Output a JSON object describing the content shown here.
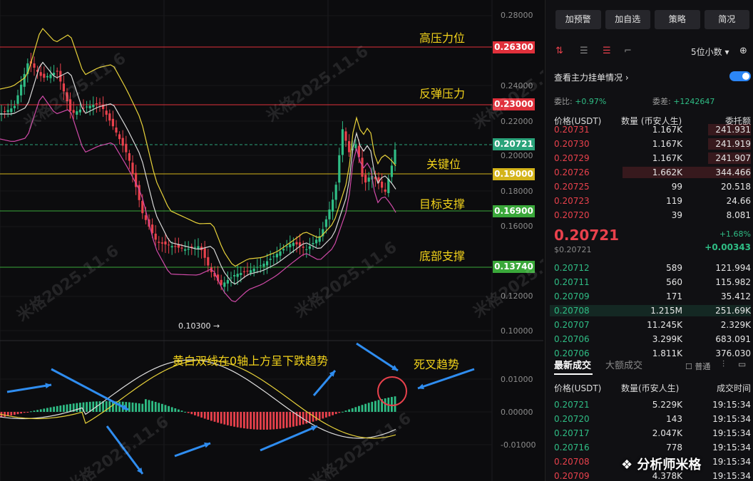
{
  "chart": {
    "axis_ticks": [
      "0.28000",
      "0.24000",
      "0.22000",
      "0.20000",
      "0.18000",
      "0.16000",
      "0.12000",
      "0.10000"
    ],
    "macd_ticks": [
      "0.01000",
      "0.00000",
      "-0.01000"
    ],
    "price_tags": [
      {
        "label": "0.26300",
        "color": "#e0303b"
      },
      {
        "label": "0.23000",
        "color": "#e0303b"
      },
      {
        "label": "0.20721",
        "color": "#2aa37a"
      },
      {
        "label": "0.19000",
        "color": "#d4b41a"
      },
      {
        "label": "0.16900",
        "color": "#3aa83a"
      },
      {
        "label": "0.13740",
        "color": "#3aa83a"
      }
    ],
    "annotations": {
      "high_resistance": "高压力位",
      "rebound_resistance": "反弹压力",
      "key_level": "关键位",
      "target_support": "目标支撑",
      "bottom_support": "底部支撑",
      "macd_note": "黄白双线在0轴上方呈下跌趋势",
      "death_cross": "死叉趋势"
    },
    "low_marker": "0.10300 →",
    "watermark": "米格2025.11.6"
  },
  "panel": {
    "buttons": [
      "加预警",
      "加自选",
      "策略",
      "简况"
    ],
    "decimal_select": "5位小数",
    "main_orders_label": "查看主力挂单情况",
    "commission_ratio_label": "委比:",
    "commission_ratio": "+0.97%",
    "commission_diff_label": "委差:",
    "commission_diff": "+1242647",
    "headers": {
      "price": "价格(USDT)",
      "qty": "数量 (币安人生)",
      "amount": "委托额"
    },
    "asks": [
      {
        "price": "0.20731",
        "qty": "1.167K",
        "amt": "241.931"
      },
      {
        "price": "0.20730",
        "qty": "1.167K",
        "amt": "241.919"
      },
      {
        "price": "0.20729",
        "qty": "1.167K",
        "amt": "241.907"
      },
      {
        "price": "0.20726",
        "qty": "1.662K",
        "amt": "344.466"
      },
      {
        "price": "0.20725",
        "qty": "99",
        "amt": "20.518"
      },
      {
        "price": "0.20723",
        "qty": "119",
        "amt": "24.66"
      },
      {
        "price": "0.20720",
        "qty": "39",
        "amt": "8.081"
      }
    ],
    "last_price": "0.20721",
    "last_price_sub": "$0.20721",
    "change_pct": "+1.68%",
    "change_abs": "+0.00343",
    "bids": [
      {
        "price": "0.20712",
        "qty": "589",
        "amt": "121.994"
      },
      {
        "price": "0.20711",
        "qty": "560",
        "amt": "115.982"
      },
      {
        "price": "0.20709",
        "qty": "171",
        "amt": "35.412"
      },
      {
        "price": "0.20708",
        "qty": "1.215M",
        "amt": "251.69K"
      },
      {
        "price": "0.20707",
        "qty": "11.245K",
        "amt": "2.329K"
      },
      {
        "price": "0.20706",
        "qty": "3.299K",
        "amt": "683.091"
      },
      {
        "price": "0.20706",
        "qty": "1.811K",
        "amt": "376.030"
      }
    ],
    "trade_tabs": [
      "最新成交",
      "大额成交"
    ],
    "normal_label": "普通",
    "trade_headers": {
      "price": "价格(USDT)",
      "qty": "数量(币安人生)",
      "time": "成交时间"
    },
    "trades": [
      {
        "price": "0.20721",
        "qty": "5.229K",
        "time": "19:15:34",
        "side": "buy"
      },
      {
        "price": "0.20720",
        "qty": "143",
        "time": "19:15:34",
        "side": "buy"
      },
      {
        "price": "0.20717",
        "qty": "2.047K",
        "time": "19:15:34",
        "side": "buy"
      },
      {
        "price": "0.20716",
        "qty": "778",
        "time": "19:15:34",
        "side": "buy"
      },
      {
        "price": "0.20708",
        "qty": "",
        "time": "19:15:34",
        "side": "sell"
      },
      {
        "price": "0.20709",
        "qty": "4.378K",
        "time": "19:15:34",
        "side": "sell"
      }
    ],
    "brand": "分析师米格"
  }
}
